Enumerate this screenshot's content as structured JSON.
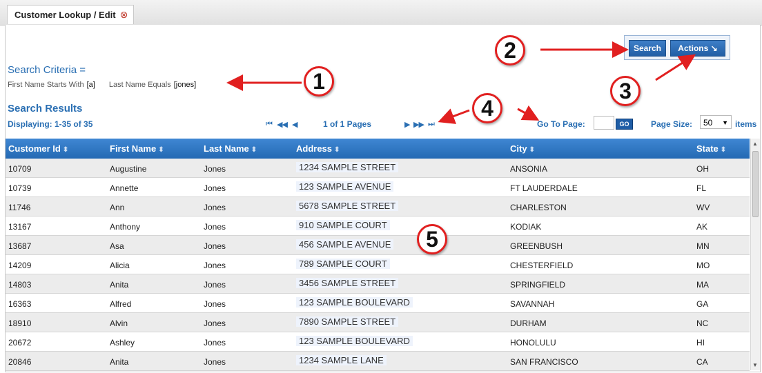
{
  "tab": {
    "label": "Customer Lookup / Edit",
    "close_icon": "⊗"
  },
  "criteria": {
    "title": "Search Criteria =",
    "first_label": "First Name Starts With",
    "first_value": "[a]",
    "last_label": "Last Name Equals",
    "last_value": "[jones]"
  },
  "results": {
    "title": "Search Results",
    "displaying": "Displaying: 1-35 of 35"
  },
  "buttons": {
    "search": "Search",
    "actions": "Actions ↘"
  },
  "pager": {
    "first_icon": "⏮",
    "prev_fast_icon": "◀◀",
    "prev_icon": "◀",
    "pages_text": "1 of 1 Pages",
    "next_icon": "▶",
    "next_fast_icon": "▶▶",
    "last_icon": "⏭",
    "goto_label": "Go To Page:",
    "go_label": "GO",
    "size_label": "Page Size:",
    "size_value": "50",
    "items_label": "items"
  },
  "columns": [
    "Customer Id",
    "First Name",
    "Last Name",
    "Address",
    "City",
    "State"
  ],
  "rows": [
    [
      "10709",
      "Augustine",
      "Jones",
      "1234 SAMPLE STREET",
      "ANSONIA",
      "OH"
    ],
    [
      "10739",
      "Annette",
      "Jones",
      "123 SAMPLE AVENUE",
      "FT LAUDERDALE",
      "FL"
    ],
    [
      "11746",
      "Ann",
      "Jones",
      "5678 SAMPLE STREET",
      "CHARLESTON",
      "WV"
    ],
    [
      "13167",
      "Anthony",
      "Jones",
      "910 SAMPLE COURT",
      "KODIAK",
      "AK"
    ],
    [
      "13687",
      "Asa",
      "Jones",
      "456 SAMPLE AVENUE",
      "GREENBUSH",
      "MN"
    ],
    [
      "14209",
      "Alicia",
      "Jones",
      "789 SAMPLE COURT",
      "CHESTERFIELD",
      "MO"
    ],
    [
      "14803",
      "Anita",
      "Jones",
      "3456 SAMPLE STREET",
      "SPRINGFIELD",
      "MA"
    ],
    [
      "16363",
      "Alfred",
      "Jones",
      "123 SAMPLE BOULEVARD",
      "SAVANNAH",
      "GA"
    ],
    [
      "18910",
      "Alvin",
      "Jones",
      "7890 SAMPLE STREET",
      "DURHAM",
      "NC"
    ],
    [
      "20672",
      "Ashley",
      "Jones",
      "123 SAMPLE BOULEVARD",
      "HONOLULU",
      "HI"
    ],
    [
      "20846",
      "Anita",
      "Jones",
      "1234 SAMPLE LANE",
      "SAN FRANCISCO",
      "CA"
    ]
  ],
  "callouts": [
    "1",
    "2",
    "3",
    "4",
    "5"
  ],
  "colors": {
    "accent": "#2a6fb3",
    "header": "#2469b3",
    "callout_ring": "#e12020",
    "arrow": "#e12020"
  }
}
